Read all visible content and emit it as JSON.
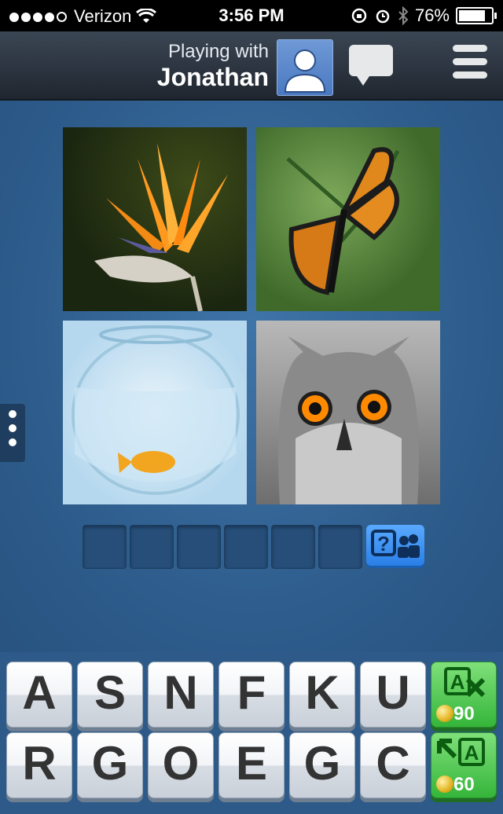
{
  "status_bar": {
    "carrier": "Verizon",
    "time": "3:56 PM",
    "battery": "76%",
    "battery_level": 0.76,
    "signal_dots": [
      1,
      1,
      1,
      1,
      0
    ]
  },
  "header": {
    "playing_with_label": "Playing with",
    "opponent_name": "Jonathan",
    "avatar_icon": "person-avatar-icon",
    "chat_icon": "chat-bubble-icon",
    "menu_icon": "hamburger-menu-icon"
  },
  "puzzle": {
    "images": [
      {
        "name": "bird-of-paradise-flower-image"
      },
      {
        "name": "monarch-butterfly-image"
      },
      {
        "name": "goldfish-bowl-image"
      },
      {
        "name": "owl-image"
      }
    ],
    "answer_slots": [
      "",
      "",
      "",
      "",
      "",
      ""
    ],
    "hint_button_icon": "question-people-icon"
  },
  "keyboard": {
    "rows": [
      [
        "A",
        "S",
        "N",
        "F",
        "K",
        "U"
      ],
      [
        "R",
        "G",
        "O",
        "E",
        "G",
        "C"
      ]
    ],
    "powerups": [
      {
        "label": "A",
        "icon": "remove-letters-icon",
        "cost": "90"
      },
      {
        "label": "A",
        "icon": "reveal-letter-icon",
        "cost": "60"
      }
    ]
  },
  "colors": {
    "background": "#2f5f8f",
    "header": "#2a333e",
    "key_face": "#f2f4f7",
    "powerup_green": "#35b53a",
    "hint_blue": "#2a7fe6"
  }
}
